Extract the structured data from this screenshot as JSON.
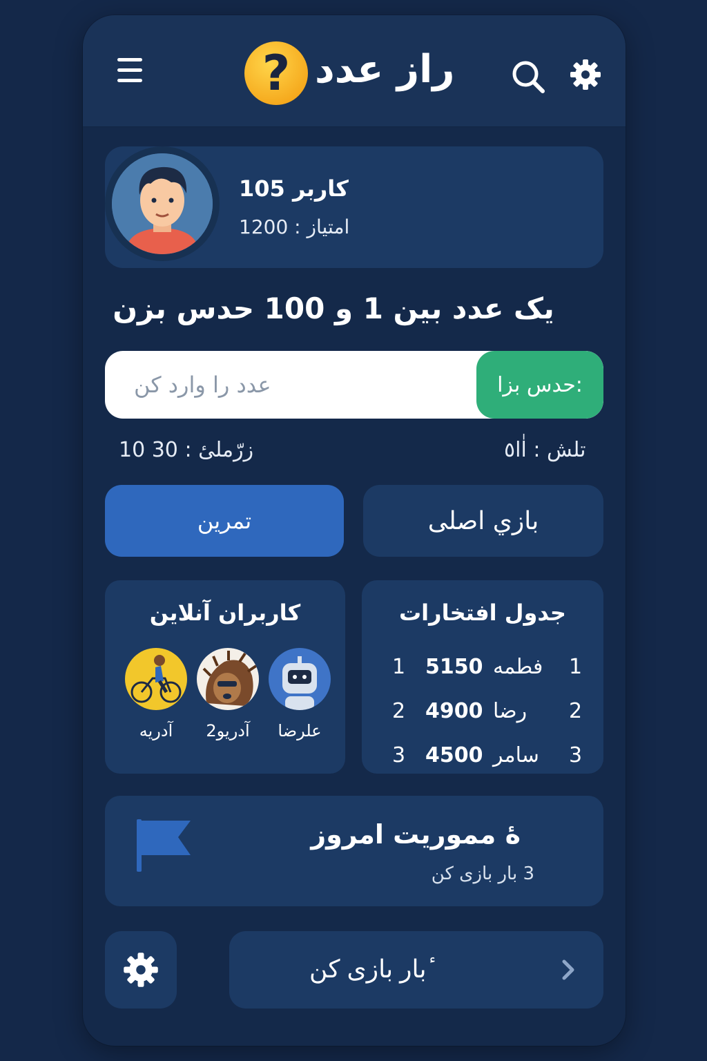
{
  "header": {
    "title": "راز عدد",
    "logo_glyph": "?",
    "icons": [
      "menu-icon",
      "logo-question-icon",
      "search-icon",
      "gear-icon"
    ]
  },
  "profile": {
    "username": "کاربر 105",
    "score": "امتیاز : 1200"
  },
  "game": {
    "prompt": "یک عدد بین 1 و 100 حدس بزن",
    "input_placeholder": "عدد را وارد کن",
    "guess_button": "حدس بزا:",
    "timer": "10 زرّملیٔ : 30",
    "attempts": "تلش : اٰا٥"
  },
  "modes": {
    "practice": "تمرین",
    "main": "بازي اصلی"
  },
  "online": {
    "title": "کاربران آنلاین",
    "users": [
      {
        "name": "آدریه",
        "icon": "cyclist-avatar"
      },
      {
        "name": "آدریو2",
        "icon": "hedgehog-avatar"
      },
      {
        "name": "علرضا",
        "icon": "robot-avatar"
      }
    ]
  },
  "leaderboard": {
    "title": "جدول افتخارات",
    "rows": [
      {
        "rank_left": "1",
        "points": "5150",
        "name": "فطمه",
        "rank_right": "1"
      },
      {
        "rank_left": "2",
        "points": "4900",
        "name": "رضا",
        "rank_right": "2"
      },
      {
        "rank_left": "3",
        "points": "4500",
        "name": "سامر",
        "rank_right": "3"
      }
    ]
  },
  "mission": {
    "title": "ۀ مموریت امروز",
    "subtitle": "3 بار بازی کن",
    "icon": "flag-icon"
  },
  "footer": {
    "play_label": "ٔبار بازی کن",
    "icons": [
      "settings-gear-icon",
      "chevron-right-icon"
    ]
  },
  "colors": {
    "background": "#142849",
    "card": "#1c3a64",
    "accent_green": "#2fae79",
    "accent_blue": "#2f68bd",
    "logo_yellow": "#f5a81c"
  }
}
